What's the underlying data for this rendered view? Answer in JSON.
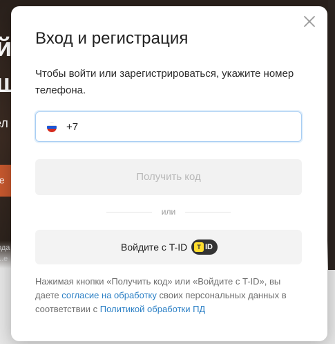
{
  "background": {
    "line1": "й",
    "line2": "ш",
    "line3": "ел",
    "button_label": "ге",
    "small1": "ода",
    "small2": "...е"
  },
  "modal": {
    "title": "Вход и регистрация",
    "subtitle": "Чтобы войти или зарегистрироваться, укажите номер телефона.",
    "phone_prefix": "+7",
    "get_code_label": "Получить код",
    "or_label": "или",
    "tid_label": "Войдите с T-ID",
    "tid_badge_logo": "T",
    "tid_badge_text": "ID",
    "legal": {
      "part1": "Нажимая кнопки «Получить код» или «Войдите с T-ID», вы даете ",
      "link1": "согласие на обработку",
      "part2": " своих персональных данных в соответствии с ",
      "link2": "Политикой обработки ПД"
    },
    "icons": {
      "close": "close-icon",
      "flag": "russia-flag-icon",
      "tid": "tid-logo-icon"
    },
    "colors": {
      "accent_link": "#2a7fc5",
      "focus_border": "#a7cdf3",
      "tid_yellow": "#ffdd2d"
    }
  }
}
